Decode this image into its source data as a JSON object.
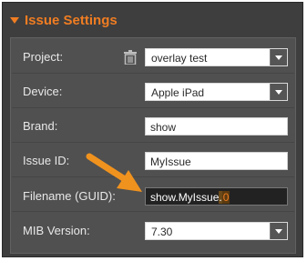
{
  "header": {
    "title": "Issue Settings",
    "expand_icon": "triangle-down-icon",
    "accent": "#f07d22"
  },
  "fields": {
    "project": {
      "label": "Project:",
      "value": "overlay test"
    },
    "device": {
      "label": "Device:",
      "value": "Apple iPad"
    },
    "brand": {
      "label": "Brand:",
      "value": "show"
    },
    "issue_id": {
      "label": "Issue ID:",
      "value": "MyIssue"
    },
    "filename": {
      "label": "Filename (GUID):",
      "prefix": "show.",
      "issue": "MyIssue",
      "dot": ".",
      "suffix": "0"
    },
    "mib_version": {
      "label": "MIB Version:",
      "value": "7.30"
    }
  },
  "annotation": {
    "arrow_color": "#f0921e",
    "icon": "callout-arrow-icon"
  }
}
